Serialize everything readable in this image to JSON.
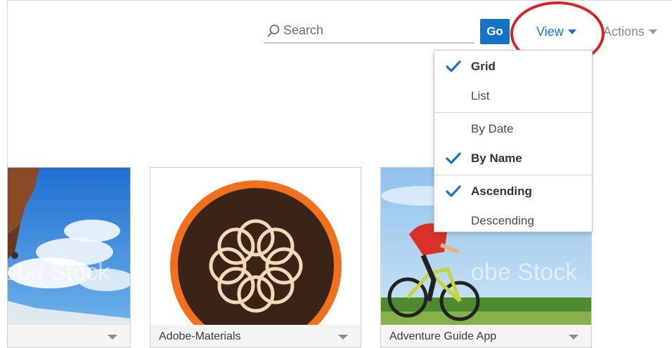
{
  "toolbar": {
    "search_placeholder": "Search",
    "go_label": "Go",
    "view_label": "View",
    "actions_label": "Actions"
  },
  "view_menu": {
    "groups": [
      {
        "items": [
          {
            "label": "Grid",
            "checked": true
          },
          {
            "label": "List",
            "checked": false
          }
        ]
      },
      {
        "items": [
          {
            "label": "By Date",
            "checked": false
          },
          {
            "label": "By Name",
            "checked": true
          }
        ]
      },
      {
        "items": [
          {
            "label": "Ascending",
            "checked": true
          },
          {
            "label": "Descending",
            "checked": false
          }
        ]
      }
    ]
  },
  "cards": [
    {
      "title": "",
      "watermark": "obe Stock"
    },
    {
      "title": "Adobe-Materials",
      "watermark": ""
    },
    {
      "title": "Adventure Guide App",
      "watermark": "obe Stock"
    }
  ],
  "colors": {
    "accent": "#1473c6",
    "link": "#1a73c8",
    "highlight": "#d8222a",
    "logo_orange": "#f0701e",
    "logo_dark": "#3a2418",
    "logo_cream": "#f4d9b8"
  },
  "icons": {
    "search": "search-icon",
    "check": "check-icon",
    "caret": "chevron-down-icon"
  }
}
